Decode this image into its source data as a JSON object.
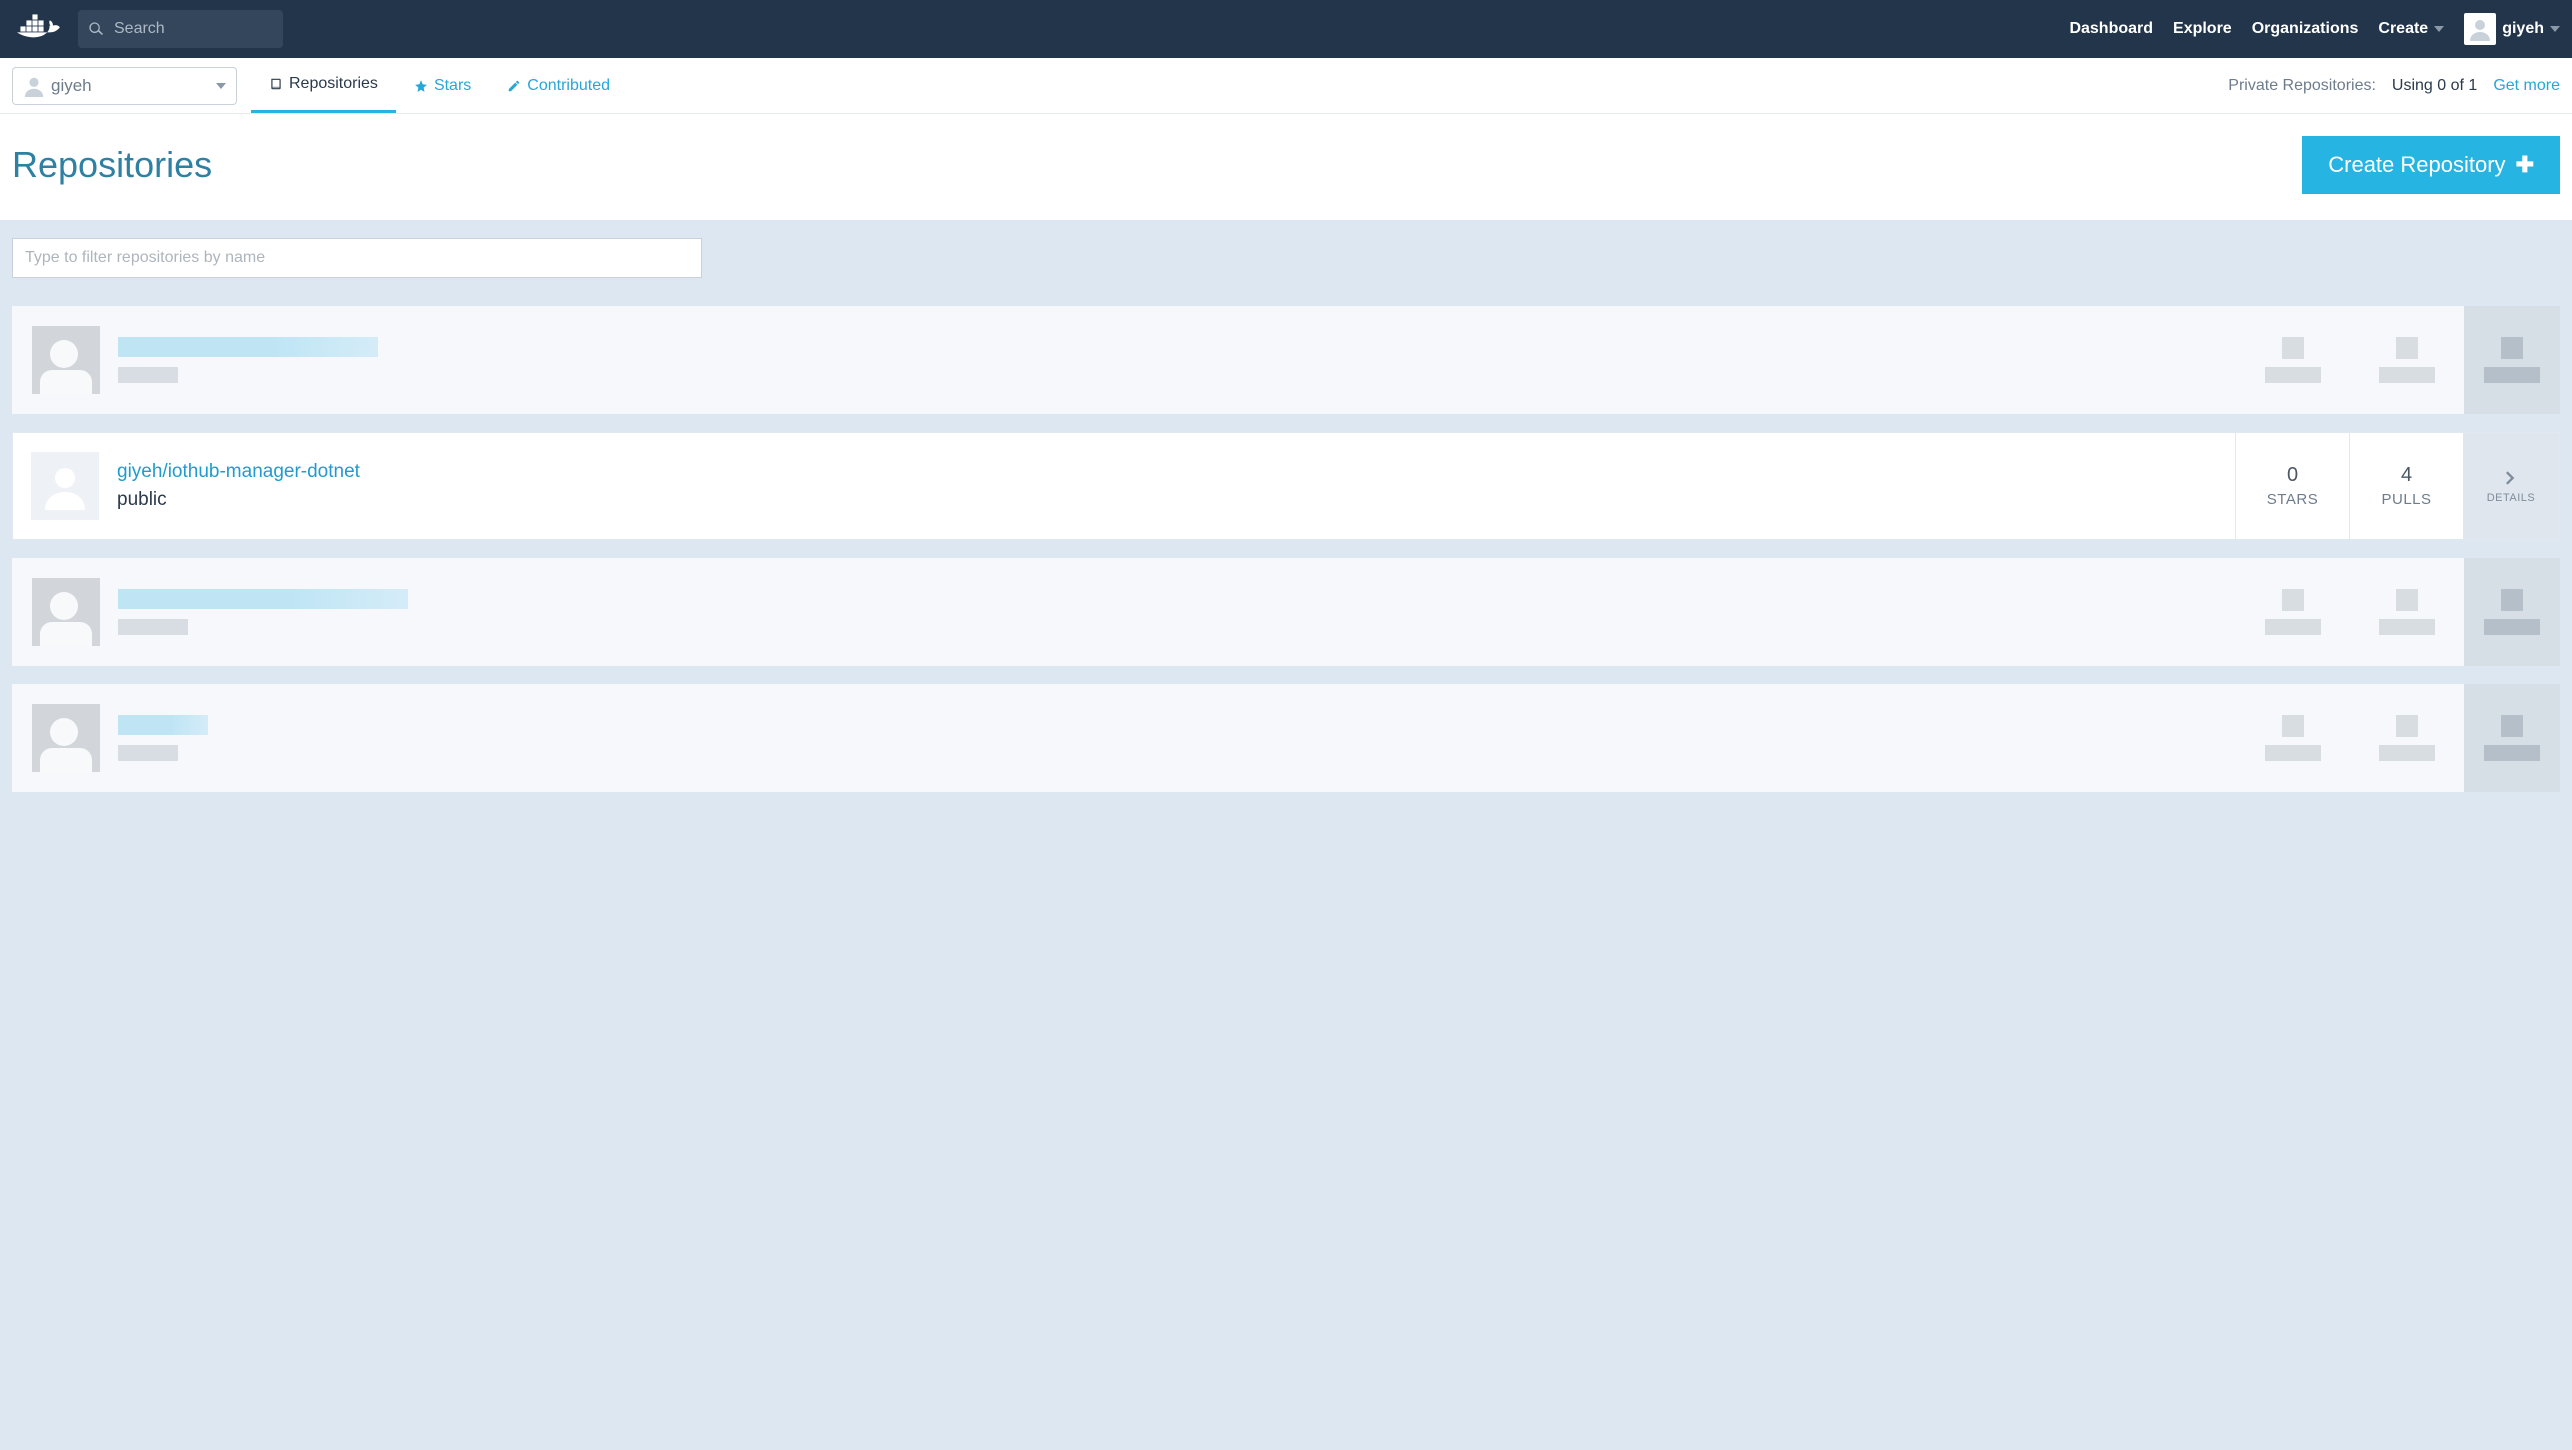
{
  "topnav": {
    "search_placeholder": "Search",
    "links": {
      "dashboard": "Dashboard",
      "explore": "Explore",
      "organizations": "Organizations",
      "create": "Create"
    },
    "username": "giyeh"
  },
  "subnav": {
    "user_selector": "giyeh",
    "tabs": {
      "repositories": "Repositories",
      "stars": "Stars",
      "contributed": "Contributed"
    },
    "private_repos_label": "Private Repositories:",
    "private_repos_usage": "Using 0 of 1",
    "get_more": "Get more"
  },
  "page": {
    "title": "Repositories",
    "create_button": "Create Repository"
  },
  "filter": {
    "placeholder": "Type to filter repositories by name"
  },
  "repo": {
    "name": "giyeh/iothub-manager-dotnet",
    "visibility": "public",
    "stars_count": "0",
    "stars_label": "STARS",
    "pulls_count": "4",
    "pulls_label": "PULLS",
    "details_label": "DETAILS"
  }
}
